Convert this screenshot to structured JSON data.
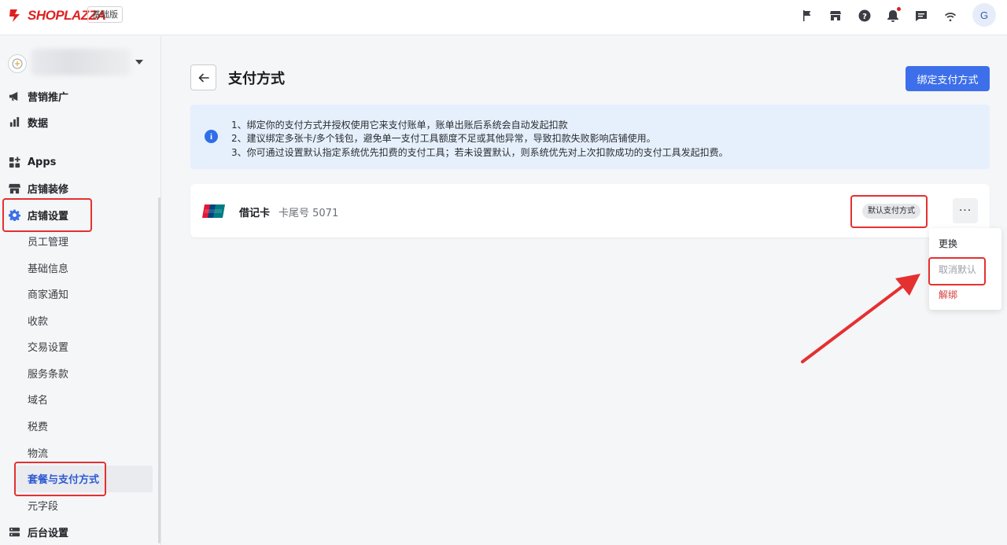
{
  "topbar": {
    "brand": "SHOPLAZZA",
    "plan": "基础版",
    "avatar_initial": "G",
    "icons": [
      "flag-icon",
      "store-icon",
      "help-icon",
      "bell-icon",
      "message-icon",
      "wifi-icon"
    ]
  },
  "sidebar": {
    "sections": [
      {
        "label": "营销推广",
        "icon": "megaphone-icon"
      },
      {
        "label": "数据",
        "icon": "bar-chart-icon"
      },
      {
        "label": "Apps",
        "icon": "apps-grid-icon"
      },
      {
        "label": "店铺装修",
        "icon": "storefront-icon"
      },
      {
        "label": "店铺设置",
        "icon": "gear-icon"
      },
      {
        "label": "后台设置",
        "icon": "server-icon"
      }
    ],
    "sub_items": [
      "员工管理",
      "基础信息",
      "商家通知",
      "收款",
      "交易设置",
      "服务条款",
      "域名",
      "税费",
      "物流",
      "套餐与支付方式",
      "元字段"
    ]
  },
  "main": {
    "title": "支付方式",
    "bind_button": "绑定支付方式",
    "info_lines": [
      "1、绑定你的支付方式并授权使用它来支付账单，账单出账后系统会自动发起扣款",
      "2、建议绑定多张卡/多个钱包，避免单一支付工具额度不足或其他异常，导致扣款失败影响店铺使用。",
      "3、你可通过设置默认指定系统优先扣费的支付工具；若未设置默认，则系统优先对上次扣款成功的支付工具发起扣费。"
    ],
    "card": {
      "type": "借记卡",
      "tail": "卡尾号 5071",
      "default_tag": "默认支付方式",
      "more": "···"
    },
    "dropdown": {
      "replace": "更换",
      "cancel_default": "取消默认",
      "unbind": "解绑"
    }
  },
  "colors": {
    "brand_red": "#e02020",
    "primary_blue": "#3d6fea",
    "info_bg": "#e6f0fd",
    "highlight_red": "#e53030"
  }
}
